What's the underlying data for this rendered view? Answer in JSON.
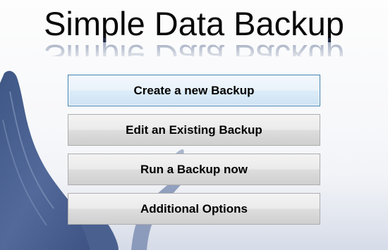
{
  "app": {
    "title": "Simple Data Backup"
  },
  "menu": {
    "create_label": "Create a new Backup",
    "edit_label": "Edit an Existing Backup",
    "run_label": "Run a Backup now",
    "options_label": "Additional Options"
  },
  "colors": {
    "hand_blue": "#4d6591",
    "focus_border": "#3c7fb1"
  },
  "icons": {
    "background": "praying-hands-icon"
  }
}
